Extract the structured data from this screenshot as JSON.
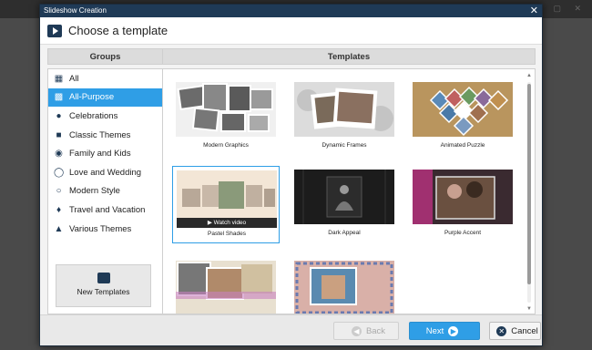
{
  "dialog": {
    "title": "Slideshow Creation",
    "header": "Choose a template"
  },
  "groups": {
    "heading": "Groups",
    "items": [
      {
        "label": "All",
        "icon": "grid-icon"
      },
      {
        "label": "All-Purpose",
        "icon": "puzzle-icon",
        "active": true
      },
      {
        "label": "Celebrations",
        "icon": "balloons-icon"
      },
      {
        "label": "Classic Themes",
        "icon": "book-icon"
      },
      {
        "label": "Family and Kids",
        "icon": "stroller-icon"
      },
      {
        "label": "Love and Wedding",
        "icon": "rings-icon"
      },
      {
        "label": "Modern Style",
        "icon": "bulb-icon"
      },
      {
        "label": "Travel and Vacation",
        "icon": "palm-icon"
      },
      {
        "label": "Various Themes",
        "icon": "cube-icon"
      }
    ],
    "new_templates": "New Templates"
  },
  "templates": {
    "heading": "Templates",
    "items": [
      {
        "label": "Modern Graphics"
      },
      {
        "label": "Dynamic Frames"
      },
      {
        "label": "Animated Puzzle"
      },
      {
        "label": "Pastel Shades",
        "selected": true,
        "watch": "Watch video"
      },
      {
        "label": "Dark Appeal"
      },
      {
        "label": "Purple Accent"
      },
      {
        "label": ""
      },
      {
        "label": ""
      }
    ]
  },
  "footer": {
    "back": "Back",
    "next": "Next",
    "cancel": "Cancel"
  },
  "colors": {
    "accent": "#2f9ee6",
    "titlebar": "#1f3a56"
  }
}
